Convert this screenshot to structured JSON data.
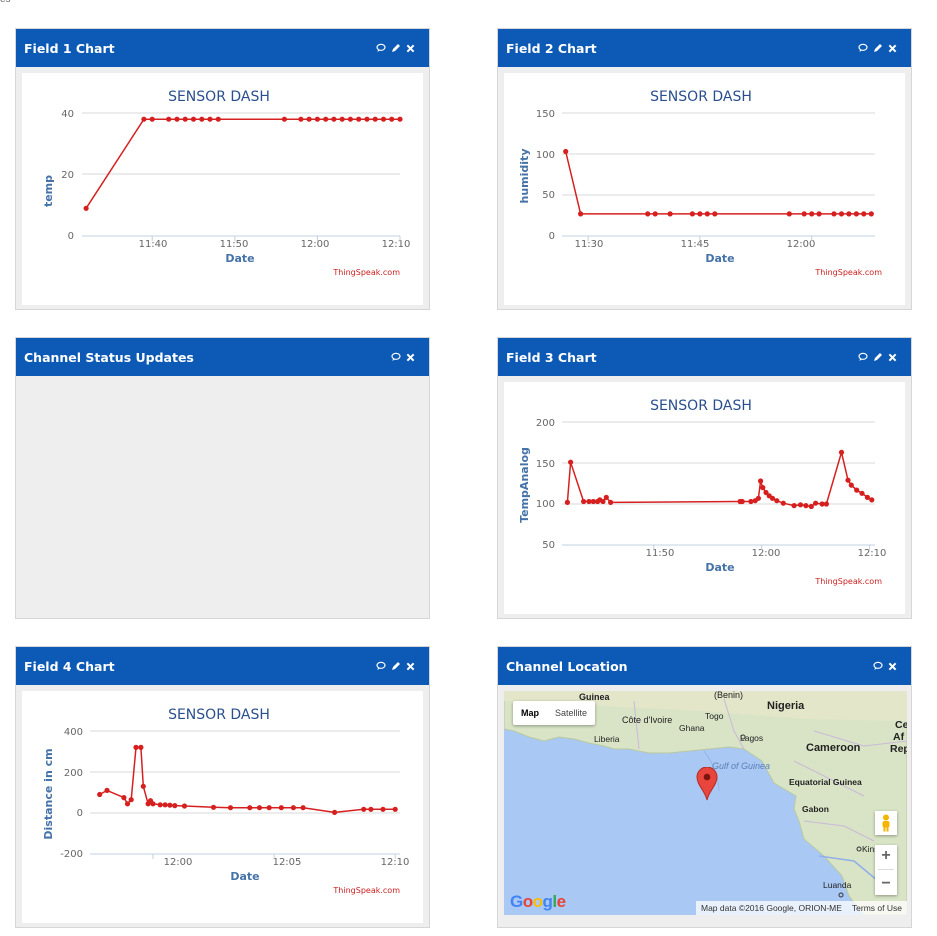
{
  "corner_text": "es",
  "panels": {
    "field1": {
      "title": "Field 1 Chart",
      "icons": [
        "comment-icon",
        "pencil-icon",
        "close-icon"
      ],
      "chart_title": "SENSOR DASH",
      "ylabel": "temp",
      "xlabel": "Date",
      "watermark": "ThingSpeak.com",
      "yticks": [
        "40",
        "20",
        "0"
      ],
      "xticks": [
        "11:40",
        "11:50",
        "12:00",
        "12:10"
      ]
    },
    "field2": {
      "title": "Field 2 Chart",
      "icons": [
        "comment-icon",
        "pencil-icon",
        "close-icon"
      ],
      "chart_title": "SENSOR DASH",
      "ylabel": "humidity",
      "xlabel": "Date",
      "watermark": "ThingSpeak.com",
      "yticks": [
        "150",
        "100",
        "50",
        "0"
      ],
      "xticks": [
        "11:30",
        "11:45",
        "12:00"
      ]
    },
    "status": {
      "title": "Channel Status Updates",
      "icons": [
        "comment-icon",
        "close-icon"
      ]
    },
    "field3": {
      "title": "Field 3 Chart",
      "icons": [
        "comment-icon",
        "pencil-icon",
        "close-icon"
      ],
      "chart_title": "SENSOR DASH",
      "ylabel": "TempAnalog",
      "xlabel": "Date",
      "watermark": "ThingSpeak.com",
      "yticks": [
        "200",
        "150",
        "100",
        "50"
      ],
      "xticks": [
        "11:50",
        "12:00",
        "12:10"
      ]
    },
    "field4": {
      "title": "Field 4 Chart",
      "icons": [
        "comment-icon",
        "pencil-icon",
        "close-icon"
      ],
      "chart_title": "SENSOR DASH",
      "ylabel": "Distance in cm",
      "xlabel": "Date",
      "watermark": "ThingSpeak.com",
      "yticks": [
        "400",
        "200",
        "0",
        "-200"
      ],
      "xticks": [
        "12:00",
        "12:05",
        "12:10"
      ]
    },
    "location": {
      "title": "Channel Location",
      "icons": [
        "comment-icon",
        "close-icon"
      ],
      "map_type_buttons": [
        "Map",
        "Satellite"
      ],
      "labels": [
        "Guinea",
        "(Benin)",
        "Nigeria",
        "Côte d'Ivoire",
        "Togo",
        "Ghana",
        "Liberia",
        "Lagos",
        "Cameroon",
        "Gulf of Guinea",
        "Equatorial Guinea",
        "Gabon",
        "Luanda",
        "Kinshasa",
        "Ce",
        "Af",
        "Rep"
      ],
      "attribution": "Map data ©2016 Google, ORION-ME",
      "terms": "Terms of Use",
      "logo": "Google",
      "zoom_in": "+",
      "zoom_out": "−"
    }
  },
  "chart_data": [
    {
      "type": "line",
      "title": "SENSOR DASH",
      "xlabel": "Date",
      "ylabel": "temp",
      "ylim": [
        0,
        40
      ],
      "series": [
        {
          "x": [
            "11:32",
            "11:39",
            "11:40",
            "11:42",
            "11:43",
            "11:44",
            "11:45",
            "11:46",
            "11:47",
            "11:48",
            "11:56",
            "11:58",
            "11:59",
            "12:00",
            "12:01",
            "12:02",
            "12:03",
            "12:04",
            "12:05",
            "12:06",
            "12:07",
            "12:08",
            "12:09",
            "12:10"
          ],
          "values": [
            9,
            38,
            38,
            38,
            38,
            38,
            38,
            38,
            38,
            38,
            38,
            38,
            38,
            38,
            38,
            38,
            38,
            38,
            38,
            38,
            38,
            38,
            38,
            38
          ]
        }
      ]
    },
    {
      "type": "line",
      "title": "SENSOR DASH",
      "xlabel": "Date",
      "ylabel": "humidity",
      "ylim": [
        0,
        150
      ],
      "series": [
        {
          "x": [
            "11:27",
            "11:29",
            "11:38",
            "11:39",
            "11:41",
            "11:44",
            "11:45",
            "11:46",
            "11:47",
            "11:57",
            "11:59",
            "12:00",
            "12:01",
            "12:03",
            "12:04",
            "12:05",
            "12:06",
            "12:07",
            "12:08"
          ],
          "values": [
            103,
            27,
            27,
            27,
            27,
            27,
            27,
            27,
            27,
            27,
            27,
            27,
            27,
            27,
            27,
            27,
            27,
            27,
            27
          ]
        }
      ]
    },
    {
      "type": "line",
      "title": "SENSOR DASH",
      "xlabel": "Date",
      "ylabel": "TempAnalog",
      "ylim": [
        50,
        200
      ],
      "series": [
        {
          "x": [
            "11:42",
            "11:42.3",
            "11:43.5",
            "11:44",
            "11:44.4",
            "11:44.8",
            "11:45",
            "11:45.3",
            "11:45.6",
            "11:46",
            "11:58",
            "11:58.2",
            "11:59",
            "11:59.4",
            "11:59.7",
            "11:59.9",
            "12:00.1",
            "12:00.4",
            "12:00.7",
            "12:01",
            "12:01.4",
            "12:02",
            "12:03",
            "12:03.6",
            "12:04.1",
            "12:04.6",
            "12:05",
            "12:05.6",
            "12:06",
            "12:07.4",
            "12:08",
            "12:08.3",
            "12:08.8",
            "12:09.3",
            "12:09.8",
            "12:10.2"
          ],
          "values": [
            102,
            151,
            103,
            103,
            103,
            103,
            105,
            103,
            108,
            102,
            103,
            103,
            103,
            104,
            107,
            128,
            120,
            114,
            110,
            107,
            104,
            101,
            98,
            99,
            98,
            97,
            101,
            100,
            100,
            163,
            129,
            123,
            117,
            113,
            108,
            105
          ]
        }
      ]
    },
    {
      "type": "line",
      "title": "SENSOR DASH",
      "xlabel": "Date",
      "ylabel": "Distance in cm",
      "ylim": [
        -200,
        400
      ],
      "series": [
        {
          "x": [
            "11:57.8",
            "11:58.1",
            "11:58.8",
            "11:58.95",
            "11:59.1",
            "11:59.3",
            "11:59.5",
            "11:59.6",
            "11:59.8",
            "11:59.9",
            "12:00",
            "12:00.3",
            "12:00.5",
            "12:00.7",
            "12:00.9",
            "12:01.3",
            "12:02.5",
            "12:03.2",
            "12:04",
            "12:04.4",
            "12:04.8",
            "12:05.3",
            "12:05.8",
            "12:06.2",
            "12:07.5",
            "12:08.7",
            "12:09",
            "12:09.5",
            "12:10"
          ],
          "values": [
            90,
            110,
            75,
            45,
            65,
            320,
            320,
            130,
            45,
            60,
            45,
            40,
            40,
            38,
            36,
            34,
            28,
            26,
            26,
            26,
            26,
            26,
            26,
            26,
            3,
            18,
            18,
            18,
            18
          ]
        }
      ]
    }
  ]
}
